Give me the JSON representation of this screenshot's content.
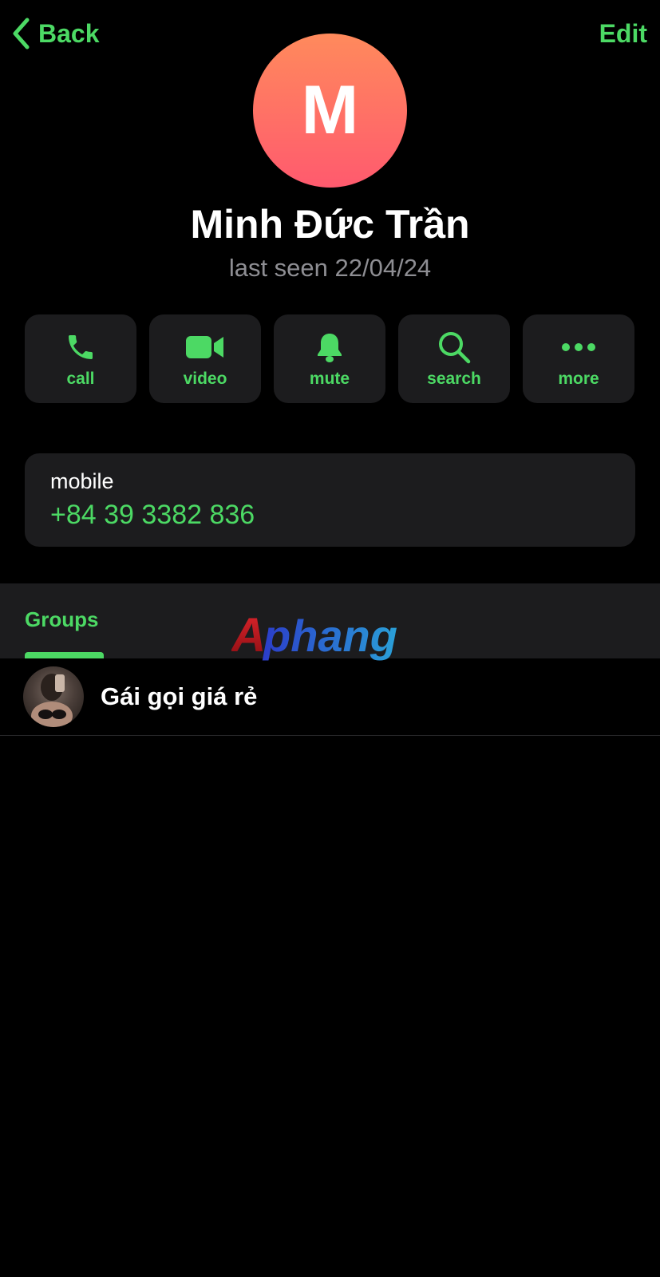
{
  "nav": {
    "back_label": "Back",
    "edit_label": "Edit"
  },
  "profile": {
    "avatar_initial": "M",
    "name": "Minh Đức Trần",
    "status": "last seen 22/04/24"
  },
  "actions": [
    {
      "label": "call",
      "icon": "phone-icon"
    },
    {
      "label": "video",
      "icon": "video-camera-icon"
    },
    {
      "label": "mute",
      "icon": "bell-icon"
    },
    {
      "label": "search",
      "icon": "search-icon"
    },
    {
      "label": "more",
      "icon": "more-dots-icon"
    }
  ],
  "contact_info": {
    "label": "mobile",
    "value": "+84 39 3382 836"
  },
  "tabs": {
    "groups_label": "Groups"
  },
  "watermark": {
    "text": "Aphang"
  },
  "groups": [
    {
      "name": "Gái gọi giá rẻ"
    }
  ],
  "colors": {
    "accent": "#4cd964",
    "background": "#000000",
    "card": "#1c1c1e",
    "secondary_text": "#8e8e93",
    "avatar_gradient_top": "#ff8a5c",
    "avatar_gradient_bottom": "#ff5a6e"
  }
}
